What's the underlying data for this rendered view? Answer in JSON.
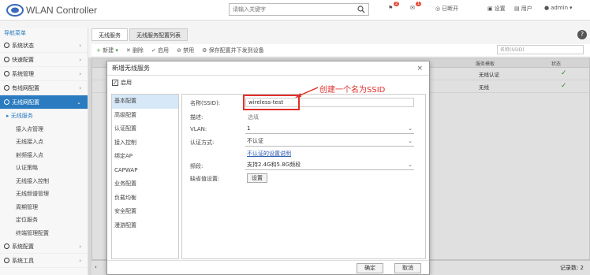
{
  "app": {
    "title": "WLAN Controller"
  },
  "header": {
    "search_placeholder": "请输入关键字",
    "alerts_count": "2",
    "messages_count": "1",
    "notice": "已断开",
    "settings": "设置",
    "users": "用户",
    "user": "admin"
  },
  "sidebar": {
    "header": "导航菜单",
    "items": [
      {
        "label": "系统状态"
      },
      {
        "label": "快速配置"
      },
      {
        "label": "系统管理"
      },
      {
        "label": "有线网配置"
      },
      {
        "label": "无线网配置"
      }
    ],
    "sub_items": [
      "无线服务",
      "接入点管理",
      "无线接入点",
      "射频接入点",
      "认证策略",
      "无线接入控制",
      "无线频谱管理",
      "周期管理",
      "定位服务",
      "终端管理配置"
    ],
    "bottom_items": [
      {
        "label": "系统配置"
      },
      {
        "label": "系统工具"
      }
    ]
  },
  "tabs": [
    "无线服务",
    "无线服务配置列表"
  ],
  "toolbar": {
    "add": "新建",
    "delete": "删除",
    "enable": "启用",
    "disable": "禁用",
    "more": "保存配置并下发到设备"
  },
  "ssid_search_placeholder": "名称(SSID)",
  "grid": {
    "columns": [
      "服务模板",
      "状态"
    ],
    "rows": [
      {
        "template": "无线认证",
        "status": "✓"
      },
      {
        "template": "无线",
        "status": "✓"
      }
    ]
  },
  "pager": {
    "text": "记录数: 2"
  },
  "dialog": {
    "title": "新增无线服务",
    "enable_label": "启用",
    "enable_mark": "✓",
    "close": "×",
    "nav": [
      "基本配置",
      "高级配置",
      "认证配置",
      "接入控制",
      "绑定AP",
      "CAPWAP",
      "业务配置",
      "负载均衡",
      "安全配置",
      "漫游配置"
    ],
    "fields": {
      "ssid_label": "名称(SSID):",
      "ssid_value": "wireless-test",
      "desc_label": "描述:",
      "desc_value": "选填",
      "vlan_label": "VLAN:",
      "vlan_value": "1",
      "auth_label": "认证方式:",
      "auth_value": "不认证",
      "auth_link": "不认证的设置说明",
      "band_label": "频段:",
      "band_value": "支持2.4G和5.8G频段",
      "default_label": "缺省值设置:",
      "default_btn": "设置"
    },
    "ok": "确定",
    "cancel": "取消"
  },
  "annotation": "创建一个名为SSID"
}
